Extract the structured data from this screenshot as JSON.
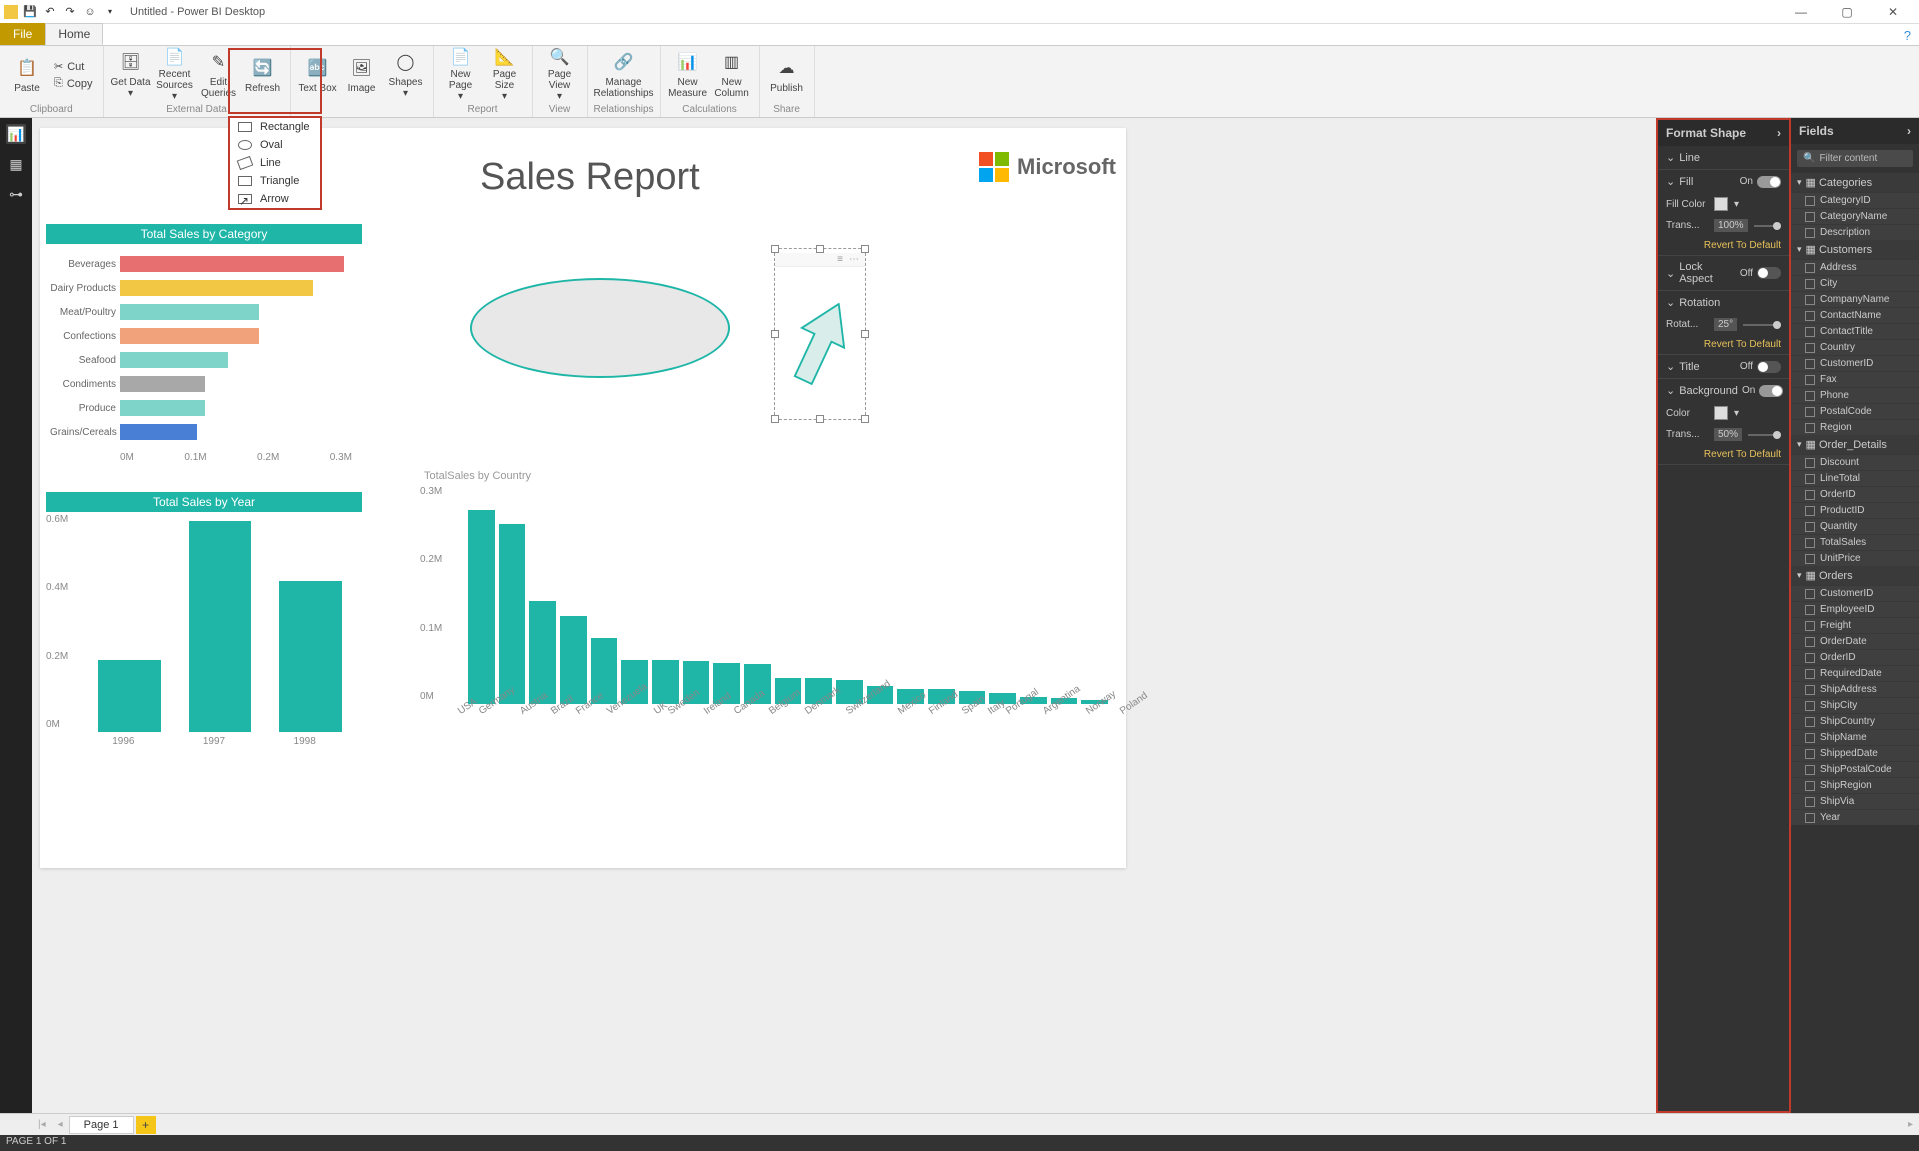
{
  "app": {
    "title": "Untitled - Power BI Desktop"
  },
  "qat": [
    "save",
    "undo",
    "redo",
    "smiley"
  ],
  "menutabs": {
    "file": "File",
    "home": "Home"
  },
  "ribbon": {
    "clipboard": {
      "label": "Clipboard",
      "paste": "Paste",
      "cut": "Cut",
      "copy": "Copy"
    },
    "externaldata": {
      "label": "External Data",
      "getdata": "Get Data",
      "recentsources": "Recent Sources",
      "editqueries": "Edit Queries",
      "refresh": "Refresh"
    },
    "insert": {
      "label": "",
      "textbox": "Text Box",
      "image": "Image",
      "shapes": "Shapes"
    },
    "report": {
      "label": "Report",
      "newpage": "New Page",
      "pagesize": "Page Size"
    },
    "view": {
      "label": "View",
      "pageview": "Page View"
    },
    "relationships": {
      "label": "Relationships",
      "manage": "Manage Relationships"
    },
    "calculations": {
      "label": "Calculations",
      "newmeasure": "New Measure",
      "newcolumn": "New Column"
    },
    "share": {
      "label": "Share",
      "publish": "Publish"
    }
  },
  "shapes_dd": [
    "Rectangle",
    "Oval",
    "Line",
    "Triangle",
    "Arrow"
  ],
  "report": {
    "title": "Sales Report",
    "mslogo_text": "Microsoft"
  },
  "chart_data": [
    {
      "id": "cat",
      "title": "Total Sales by Category",
      "type": "bar",
      "orientation": "horizontal",
      "categories": [
        "Beverages",
        "Dairy Products",
        "Meat/Poultry",
        "Confections",
        "Seafood",
        "Condiments",
        "Produce",
        "Grains/Cereals"
      ],
      "values": [
        0.29,
        0.25,
        0.18,
        0.18,
        0.14,
        0.11,
        0.11,
        0.1
      ],
      "colors": [
        "#e76f6f",
        "#f2c744",
        "#7fd4c9",
        "#f2a27a",
        "#7fd4c9",
        "#a8a8a8",
        "#7fd4c9",
        "#4a7fd6"
      ],
      "xticks": [
        "0M",
        "0.1M",
        "0.2M",
        "0.3M"
      ],
      "xlim": [
        0,
        0.3
      ]
    },
    {
      "id": "year",
      "title": "Total Sales by Year",
      "type": "bar",
      "categories": [
        "1996",
        "1997",
        "1998"
      ],
      "values": [
        0.23,
        0.67,
        0.48
      ],
      "yticks": [
        "0M",
        "0.2M",
        "0.4M",
        "0.6M"
      ],
      "ylim": [
        0,
        0.7
      ]
    },
    {
      "id": "country",
      "title": "TotalSales by Country",
      "type": "bar",
      "categories": [
        "USA",
        "Germany",
        "Austria",
        "Brazil",
        "France",
        "Venezuela",
        "UK",
        "Sweden",
        "Ireland",
        "Canada",
        "Belgium",
        "Denmark",
        "Switzerland",
        "Mexico",
        "Finland",
        "Spain",
        "Italy",
        "Portugal",
        "Argentina",
        "Norway",
        "Poland"
      ],
      "values": [
        0.265,
        0.245,
        0.14,
        0.12,
        0.09,
        0.06,
        0.06,
        0.058,
        0.056,
        0.055,
        0.035,
        0.035,
        0.033,
        0.025,
        0.02,
        0.02,
        0.018,
        0.015,
        0.01,
        0.008,
        0.005
      ],
      "yticks": [
        "0M",
        "0.1M",
        "0.2M",
        "0.3M"
      ],
      "ylim": [
        0,
        0.3
      ]
    }
  ],
  "format": {
    "title": "Format Shape",
    "sections": {
      "line": "Line",
      "fill": "Fill",
      "fill_on": "On",
      "fillcolor": "Fill Color",
      "trans": "Trans...",
      "trans_val": "100%",
      "revert": "Revert To Default",
      "lockaspect": "Lock Aspect",
      "lock_off": "Off",
      "rotation": "Rotation",
      "rotat": "Rotat...",
      "rotat_val": "25°",
      "titlesec": "Title",
      "title_off": "Off",
      "background": "Background",
      "bg_on": "On",
      "color": "Color",
      "bg_trans": "Trans...",
      "bg_trans_val": "50%"
    }
  },
  "fields": {
    "title": "Fields",
    "filter_ph": "Filter content",
    "tables": [
      {
        "name": "Categories",
        "fields": [
          "CategoryID",
          "CategoryName",
          "Description"
        ]
      },
      {
        "name": "Customers",
        "fields": [
          "Address",
          "City",
          "CompanyName",
          "ContactName",
          "ContactTitle",
          "Country",
          "CustomerID",
          "Fax",
          "Phone",
          "PostalCode",
          "Region"
        ]
      },
      {
        "name": "Order_Details",
        "fields": [
          "Discount",
          "LineTotal",
          "OrderID",
          "ProductID",
          "Quantity",
          "TotalSales",
          "UnitPrice"
        ]
      },
      {
        "name": "Orders",
        "fields": [
          "CustomerID",
          "EmployeeID",
          "Freight",
          "OrderDate",
          "OrderID",
          "RequiredDate",
          "ShipAddress",
          "ShipCity",
          "ShipCountry",
          "ShipName",
          "ShippedDate",
          "ShipPostalCode",
          "ShipRegion",
          "ShipVia",
          "Year"
        ]
      }
    ]
  },
  "pagetabs": {
    "page1": "Page 1"
  },
  "status": "PAGE 1 OF 1"
}
